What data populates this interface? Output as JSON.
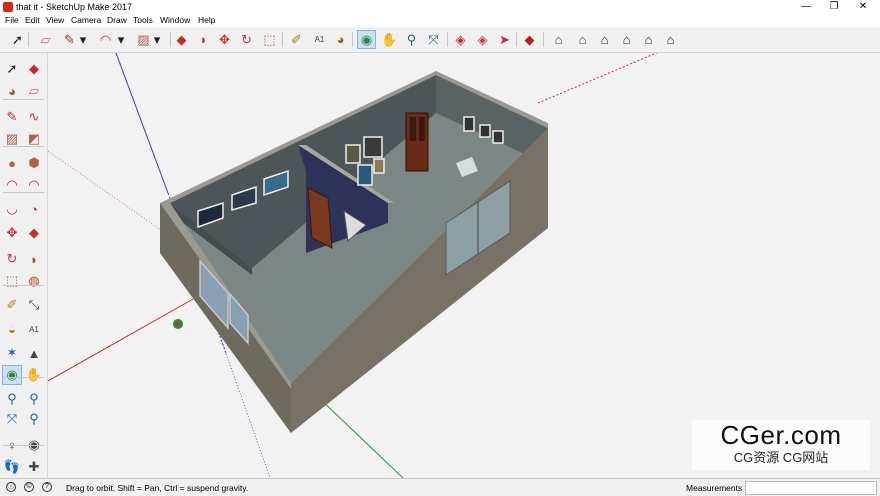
{
  "window": {
    "title": "that it - SketchUp Make 2017",
    "minimize": "—",
    "maximize": "❐",
    "close": "✕"
  },
  "menu": [
    "File",
    "Edit",
    "View",
    "Camera",
    "Draw",
    "Tools",
    "Window",
    "Help"
  ],
  "top_toolbar": [
    {
      "name": "select-icon",
      "glyph": "➚",
      "color": "#222"
    },
    {
      "name": "eraser-icon",
      "glyph": "▱",
      "color": "#e0607a"
    },
    {
      "name": "pencil-icon",
      "glyph": "✎",
      "color": "#c0302a"
    },
    {
      "name": "dropdown-arrow-icon",
      "glyph": "▾",
      "color": "#222"
    },
    {
      "name": "arc-icon",
      "glyph": "◠",
      "color": "#c0302a"
    },
    {
      "name": "dropdown-arrow-icon",
      "glyph": "▾",
      "color": "#222"
    },
    {
      "name": "rectangle-icon",
      "glyph": "▨",
      "color": "#b06050"
    },
    {
      "name": "dropdown-arrow-icon",
      "glyph": "▾",
      "color": "#222"
    },
    {
      "name": "push-pull-icon",
      "glyph": "◆",
      "color": "#c0302a"
    },
    {
      "name": "follow-me-icon",
      "glyph": "◗",
      "color": "#d03030"
    },
    {
      "name": "move-icon",
      "glyph": "✥",
      "color": "#d03030"
    },
    {
      "name": "rotate-icon",
      "glyph": "↻",
      "color": "#d03030"
    },
    {
      "name": "scale-icon",
      "glyph": "⬚",
      "color": "#c04030"
    },
    {
      "name": "tape-measure-icon",
      "glyph": "✐",
      "color": "#a08020"
    },
    {
      "name": "text-icon",
      "glyph": "A1",
      "color": "#444"
    },
    {
      "name": "paint-bucket-icon",
      "glyph": "◕",
      "color": "#8a6a20"
    },
    {
      "name": "orbit-icon",
      "glyph": "◉",
      "color": "#2a8a3a"
    },
    {
      "name": "pan-icon",
      "glyph": "✋",
      "color": "#c89060"
    },
    {
      "name": "zoom-icon",
      "glyph": "⚲",
      "color": "#2a5a9a"
    },
    {
      "name": "zoom-extents-icon",
      "glyph": "⤧",
      "color": "#2a5a9a"
    },
    {
      "name": "warehouse-icon",
      "glyph": "◈",
      "color": "#c03030"
    },
    {
      "name": "share-model-icon",
      "glyph": "◈",
      "color": "#c04040"
    },
    {
      "name": "extension-warehouse-icon",
      "glyph": "➤",
      "color": "#c03030"
    },
    {
      "name": "ruby-icon",
      "glyph": "◆",
      "color": "#b02020"
    },
    {
      "name": "iso-view-icon",
      "glyph": "⌂",
      "color": "#444"
    },
    {
      "name": "top-view-icon",
      "glyph": "⌂",
      "color": "#444"
    },
    {
      "name": "front-view-icon",
      "glyph": "⌂",
      "color": "#222"
    },
    {
      "name": "right-view-icon",
      "glyph": "⌂",
      "color": "#222"
    },
    {
      "name": "back-view-icon",
      "glyph": "⌂",
      "color": "#222"
    },
    {
      "name": "left-view-icon",
      "glyph": "⌂",
      "color": "#222"
    }
  ],
  "left_toolbar": [
    {
      "name": "select-icon",
      "glyph": "➚",
      "color": "#222"
    },
    {
      "name": "make-component-icon",
      "glyph": "◆",
      "color": "#c03030"
    },
    {
      "name": "paint-bucket-icon",
      "glyph": "◕",
      "color": "#8a6a20"
    },
    {
      "name": "eraser-icon",
      "glyph": "▱",
      "color": "#e0607a"
    },
    {
      "name": "line-icon",
      "glyph": "✎",
      "color": "#c0302a"
    },
    {
      "name": "freehand-icon",
      "glyph": "∿",
      "color": "#c0302a"
    },
    {
      "name": "rectangle-icon",
      "glyph": "▨",
      "color": "#b06050"
    },
    {
      "name": "rotated-rectangle-icon",
      "glyph": "◩",
      "color": "#b06050"
    },
    {
      "name": "circle-icon",
      "glyph": "●",
      "color": "#b06050"
    },
    {
      "name": "polygon-icon",
      "glyph": "⬢",
      "color": "#b06050"
    },
    {
      "name": "arc-icon",
      "glyph": "◠",
      "color": "#c0302a"
    },
    {
      "name": "two-point-arc-icon",
      "glyph": "◠",
      "color": "#c0302a"
    },
    {
      "name": "three-point-arc-icon",
      "glyph": "◡",
      "color": "#c0302a"
    },
    {
      "name": "pie-icon",
      "glyph": "◔",
      "color": "#c0302a"
    },
    {
      "name": "move-icon",
      "glyph": "✥",
      "color": "#d03030"
    },
    {
      "name": "push-pull-icon",
      "glyph": "◆",
      "color": "#c0302a"
    },
    {
      "name": "rotate-icon",
      "glyph": "↻",
      "color": "#d03030"
    },
    {
      "name": "follow-me-icon",
      "glyph": "◗",
      "color": "#d03030"
    },
    {
      "name": "scale-icon",
      "glyph": "⬚",
      "color": "#c04030"
    },
    {
      "name": "offset-icon",
      "glyph": "◍",
      "color": "#c04030"
    },
    {
      "name": "tape-measure-icon",
      "glyph": "✐",
      "color": "#a08020"
    },
    {
      "name": "dimension-icon",
      "glyph": "⤡",
      "color": "#444"
    },
    {
      "name": "protractor-icon",
      "glyph": "◒",
      "color": "#a08020"
    },
    {
      "name": "text-icon",
      "glyph": "A1",
      "color": "#444"
    },
    {
      "name": "axes-icon",
      "glyph": "✶",
      "color": "#2a5a9a"
    },
    {
      "name": "3d-text-icon",
      "glyph": "▲",
      "color": "#444"
    },
    {
      "name": "orbit-icon",
      "glyph": "◉",
      "color": "#2a8a3a"
    },
    {
      "name": "pan-icon",
      "glyph": "✋",
      "color": "#c89060"
    },
    {
      "name": "zoom-icon",
      "glyph": "⚲",
      "color": "#2a5a9a"
    },
    {
      "name": "zoom-window-icon",
      "glyph": "⚲",
      "color": "#2a5a9a"
    },
    {
      "name": "zoom-extents-icon",
      "glyph": "⤧",
      "color": "#2a5a9a"
    },
    {
      "name": "previous-view-icon",
      "glyph": "⚲",
      "color": "#2a5a9a"
    },
    {
      "name": "position-camera-icon",
      "glyph": "♀",
      "color": "#444"
    },
    {
      "name": "look-around-icon",
      "glyph": "◉",
      "color": "#444"
    },
    {
      "name": "walk-icon",
      "glyph": "👣",
      "color": "#222"
    },
    {
      "name": "section-plane-icon",
      "glyph": "✚",
      "color": "#444"
    }
  ],
  "status": {
    "message": "Drag to orbit. Shift = Pan, Ctrl = suspend gravity.",
    "measurements_label": "Measurements",
    "measurements_value": ""
  },
  "watermark": {
    "main": "CGer.com",
    "sub": "CG资源  CG网站"
  },
  "colors": {
    "axis_red": "#c83030",
    "axis_green": "#2a9a3a",
    "axis_blue": "#3a3ac8",
    "exterior_wall": "#6e6a5e",
    "interior_wall": "#4e5558",
    "accent_wall": "#2e3258",
    "floor": "#7c8684",
    "wall_top": "#9a9a92"
  }
}
